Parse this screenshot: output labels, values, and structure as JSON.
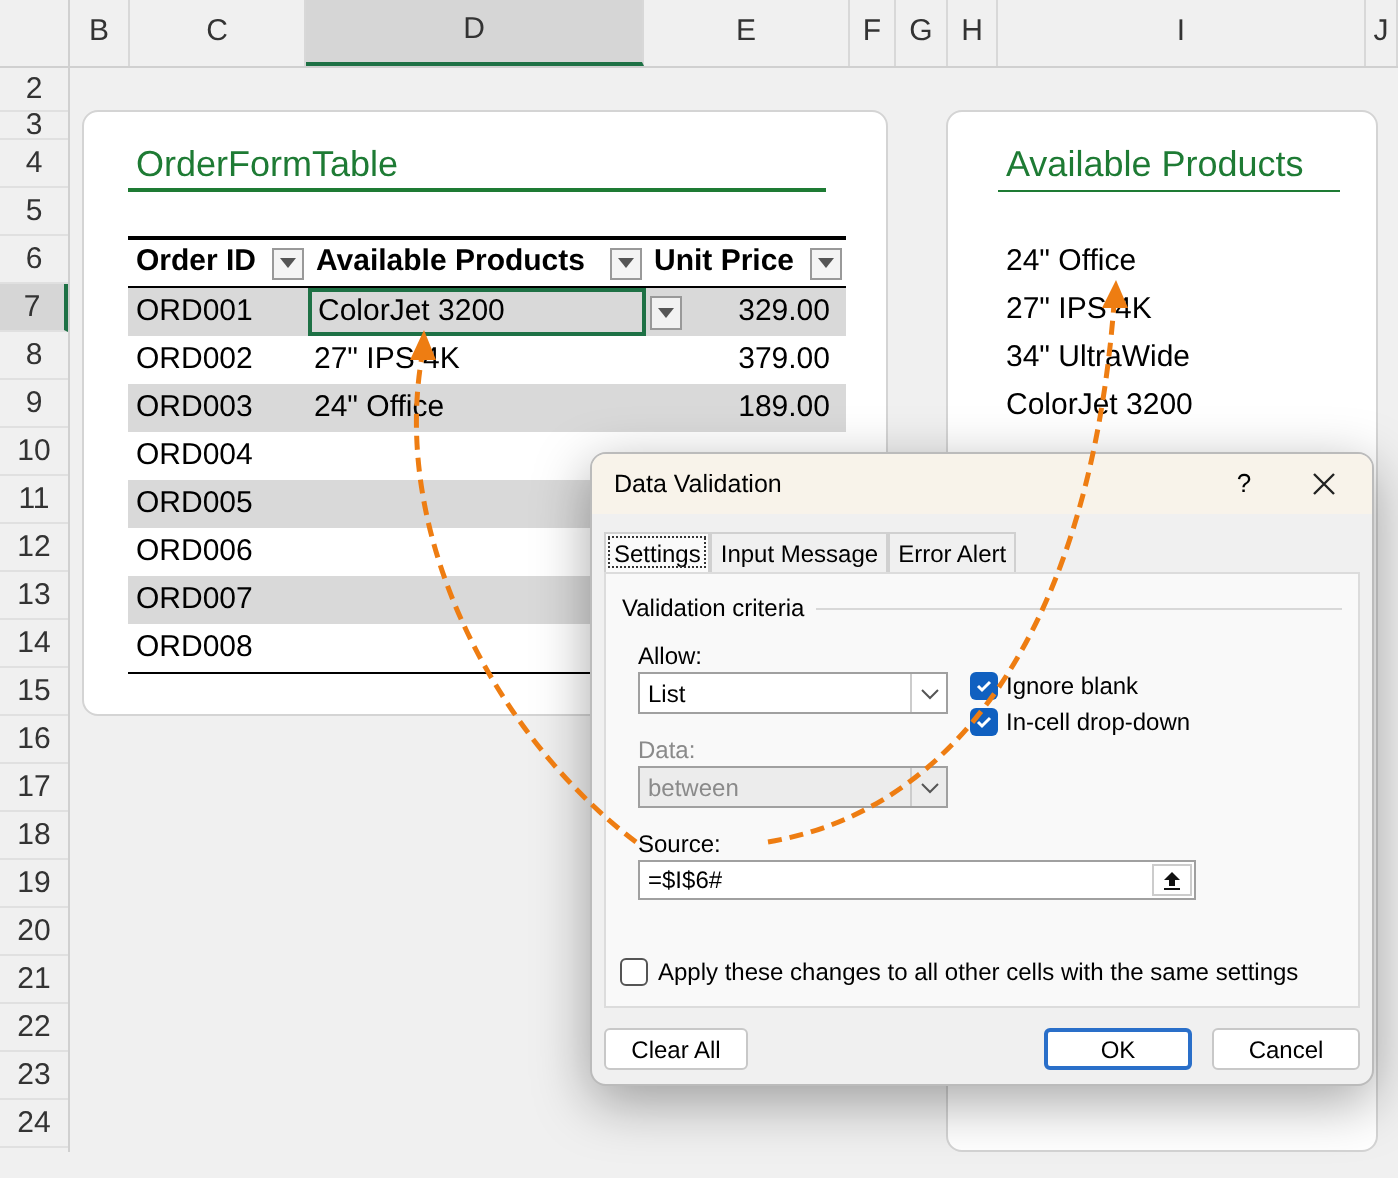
{
  "column_headers": [
    {
      "label": "B",
      "selected": false
    },
    {
      "label": "C",
      "selected": false
    },
    {
      "label": "D",
      "selected": true
    },
    {
      "label": "E",
      "selected": false
    },
    {
      "label": "F",
      "selected": false
    },
    {
      "label": "G",
      "selected": false
    },
    {
      "label": "H",
      "selected": false
    },
    {
      "label": "I",
      "selected": false
    },
    {
      "label": "J",
      "selected": false
    }
  ],
  "row_headers": [
    {
      "label": "2",
      "selected": false
    },
    {
      "label": "3",
      "selected": false
    },
    {
      "label": "4",
      "selected": false
    },
    {
      "label": "5",
      "selected": false
    },
    {
      "label": "6",
      "selected": false
    },
    {
      "label": "7",
      "selected": true
    },
    {
      "label": "8",
      "selected": false
    },
    {
      "label": "9",
      "selected": false
    },
    {
      "label": "10",
      "selected": false
    },
    {
      "label": "11",
      "selected": false
    },
    {
      "label": "12",
      "selected": false
    },
    {
      "label": "13",
      "selected": false
    },
    {
      "label": "14",
      "selected": false
    },
    {
      "label": "15",
      "selected": false
    },
    {
      "label": "16",
      "selected": false
    },
    {
      "label": "17",
      "selected": false
    },
    {
      "label": "18",
      "selected": false
    },
    {
      "label": "19",
      "selected": false
    },
    {
      "label": "20",
      "selected": false
    },
    {
      "label": "21",
      "selected": false
    },
    {
      "label": "22",
      "selected": false
    },
    {
      "label": "23",
      "selected": false
    },
    {
      "label": "24",
      "selected": false
    }
  ],
  "order_table": {
    "title": "OrderFormTable",
    "columns": [
      "Order ID",
      "Available Products",
      "Unit Price"
    ],
    "rows": [
      {
        "order_id": "ORD001",
        "product": "ColorJet 3200",
        "price": "329.00",
        "selected": true
      },
      {
        "order_id": "ORD002",
        "product": "27\" IPS 4K",
        "price": "379.00",
        "selected": false
      },
      {
        "order_id": "ORD003",
        "product": "24\" Office",
        "price": "189.00",
        "selected": false
      },
      {
        "order_id": "ORD004",
        "selected": false
      },
      {
        "order_id": "ORD005",
        "selected": false
      },
      {
        "order_id": "ORD006",
        "selected": false
      },
      {
        "order_id": "ORD007",
        "selected": false
      },
      {
        "order_id": "ORD008",
        "selected": false
      }
    ]
  },
  "products_card": {
    "title": "Available Products",
    "items": [
      "24\" Office",
      "27\" IPS 4K",
      "34\" UltraWide",
      "ColorJet 3200"
    ]
  },
  "dialog": {
    "title": "Data Validation",
    "help": "?",
    "tabs": [
      {
        "label": "Settings",
        "selected": true
      },
      {
        "label": "Input Message",
        "selected": false
      },
      {
        "label": "Error Alert",
        "selected": false
      }
    ],
    "section": "Validation criteria",
    "allow_label": "Allow:",
    "allow_value": "List",
    "data_label": "Data:",
    "data_value": "between",
    "data_disabled": true,
    "checkboxes": [
      {
        "label": "Ignore blank",
        "checked": true
      },
      {
        "label": "In-cell drop-down",
        "checked": true
      }
    ],
    "source_label": "Source:",
    "source_value": "=$I$6#",
    "apply": {
      "label": "Apply these changes to all other cells with the same settings",
      "checked": false
    },
    "buttons": [
      {
        "label": "Clear All",
        "kind": "secondary"
      },
      {
        "label": "OK",
        "kind": "default"
      },
      {
        "label": "Cancel",
        "kind": "secondary"
      }
    ]
  }
}
